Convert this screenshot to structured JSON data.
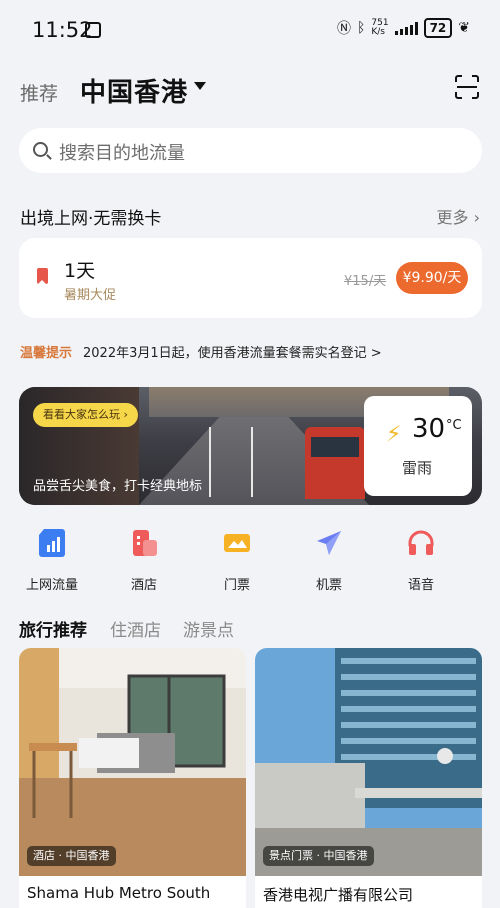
{
  "status": {
    "time": "11:52",
    "speed_value": "751",
    "speed_unit": "K/s",
    "battery": "72"
  },
  "header": {
    "tab_label": "推荐",
    "location": "中国香港"
  },
  "search": {
    "placeholder": "搜索目的地流量"
  },
  "roaming": {
    "title": "出境上网·无需换卡",
    "more": "更多"
  },
  "plan": {
    "duration": "1天",
    "promo": "暑期大促",
    "old_price": "¥15/天",
    "price": "¥9.90/天"
  },
  "notice": {
    "tag": "温馨提示",
    "text": "2022年3月1日起，使用香港流量套餐需实名登记 >"
  },
  "banner": {
    "pill": "看看大家怎么玩 ›",
    "caption": "品尝舌尖美食，打卡经典地标",
    "temperature": "30",
    "unit": "°C",
    "condition": "雷雨"
  },
  "services": [
    {
      "label": "上网流量",
      "icon": "data-signal-icon",
      "color": "#3d7df2"
    },
    {
      "label": "酒店",
      "icon": "hotel-icon",
      "color": "#ef5a5a"
    },
    {
      "label": "门票",
      "icon": "ticket-icon",
      "color": "#f7b224"
    },
    {
      "label": "机票",
      "icon": "airplane-icon",
      "color": "#6a7ef2"
    },
    {
      "label": "语音",
      "icon": "headphones-icon",
      "color": "#ef5a5a"
    }
  ],
  "tabs": [
    "旅行推荐",
    "住酒店",
    "游景点"
  ],
  "cards": [
    {
      "tag": "酒店 · 中国香港",
      "title": "Shama Hub Metro South"
    },
    {
      "tag": "景点门票 · 中国香港",
      "title": "香港电视广播有限公司"
    }
  ]
}
